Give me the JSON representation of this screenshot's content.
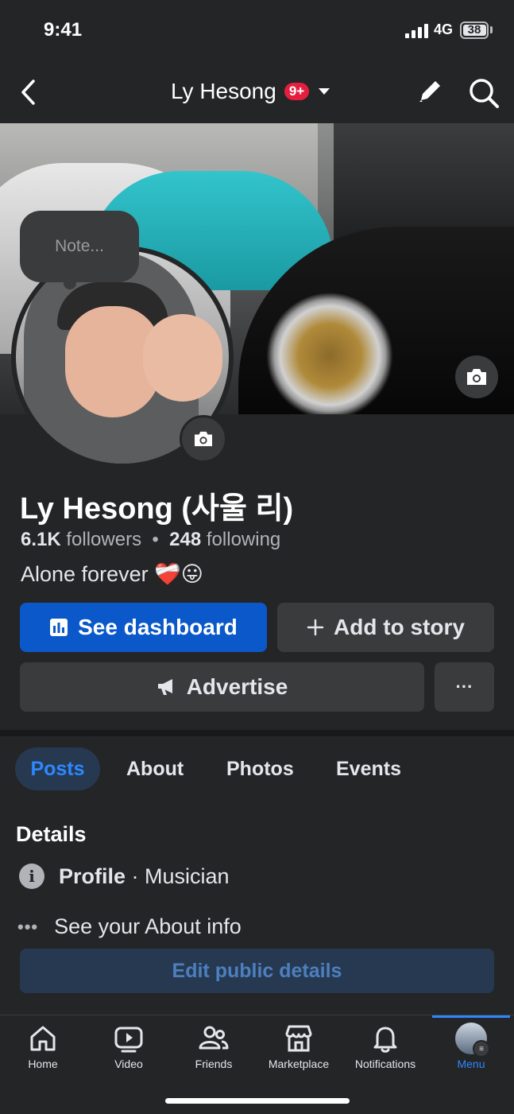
{
  "status_bar": {
    "time": "9:41",
    "network": "4G",
    "battery": "38"
  },
  "header": {
    "title": "Ly Hesong",
    "notification_badge": "9+"
  },
  "profile": {
    "note_placeholder": "Note...",
    "name": "Ly Hesong (사울 리)",
    "followers_count": "6.1K",
    "followers_label": "followers",
    "separator": "•",
    "following_count": "248",
    "following_label": "following",
    "bio": "Alone forever ❤️‍🩹😛"
  },
  "actions": {
    "dashboard_label": "See dashboard",
    "story_label": "Add to story",
    "advertise_label": "Advertise",
    "more_label": "···"
  },
  "tabs": [
    {
      "label": "Posts",
      "active": true
    },
    {
      "label": "About"
    },
    {
      "label": "Photos"
    },
    {
      "label": "Events"
    }
  ],
  "details": {
    "heading": "Details",
    "profile_label": "Profile",
    "profile_type": "· Musician",
    "about_info": "See your About info",
    "edit_button": "Edit public details"
  },
  "bottom_nav": [
    {
      "label": "Home",
      "icon": "home-icon"
    },
    {
      "label": "Video",
      "icon": "video-icon"
    },
    {
      "label": "Friends",
      "icon": "friends-icon"
    },
    {
      "label": "Marketplace",
      "icon": "marketplace-icon"
    },
    {
      "label": "Notifications",
      "icon": "bell-icon"
    },
    {
      "label": "Menu",
      "icon": "menu-avatar-icon",
      "active": true
    }
  ],
  "colors": {
    "accent": "#2d88ff",
    "primary_button": "#0a58c9",
    "background": "#242526",
    "badge": "#e41e3f"
  }
}
